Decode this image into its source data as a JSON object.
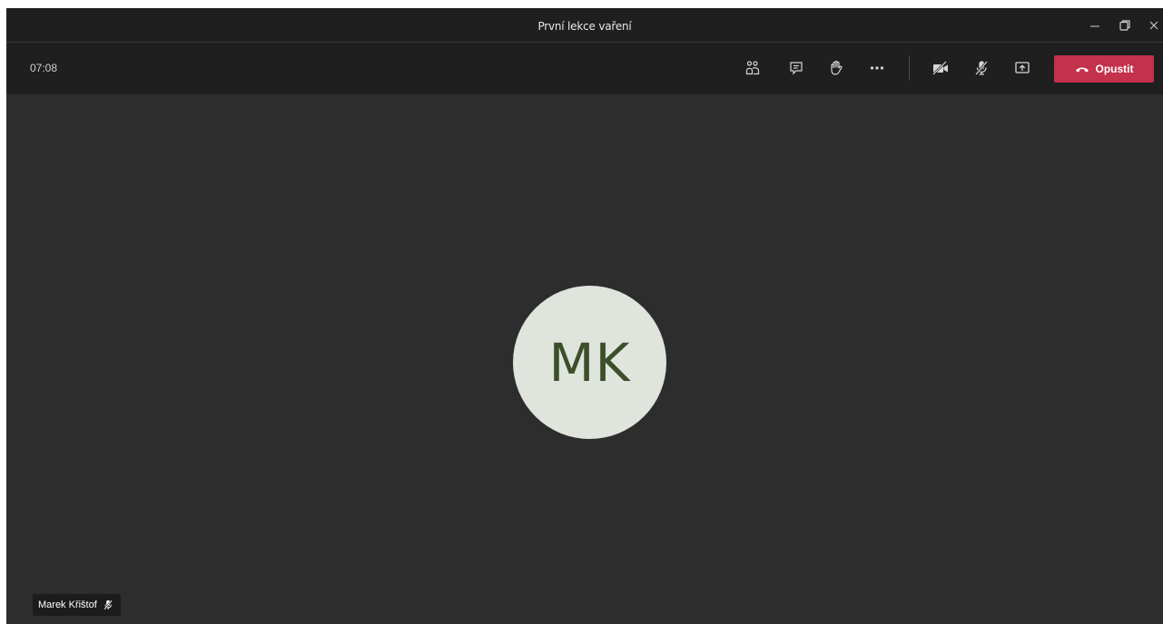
{
  "window": {
    "title": "První lekce vaření"
  },
  "toolbar": {
    "timer": "07:08",
    "buttons": [
      {
        "icon": "participants-icon"
      },
      {
        "icon": "chat-icon"
      },
      {
        "icon": "raise-hand-icon"
      },
      {
        "icon": "more-options-icon"
      },
      {
        "icon": "camera-off-icon"
      },
      {
        "icon": "mic-off-icon"
      },
      {
        "icon": "share-screen-icon"
      }
    ],
    "leave_label": "Opustit",
    "leave_color": "#c4314b"
  },
  "stage": {
    "avatar_initials": "MK",
    "avatar_bg": "#dfe4dc",
    "avatar_text_color": "#3d4e2b",
    "participant_name": "Marek Křištof",
    "participant_muted": true
  }
}
